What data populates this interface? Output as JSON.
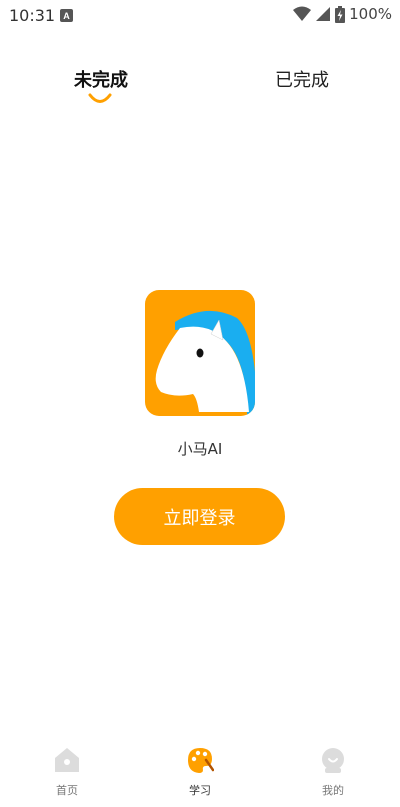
{
  "status_bar": {
    "time": "10:31",
    "battery": "100%"
  },
  "tabs": [
    {
      "label": "未完成",
      "active": true
    },
    {
      "label": "已完成",
      "active": false
    }
  ],
  "app": {
    "name": "小马AI"
  },
  "login": {
    "button_label": "立即登录"
  },
  "bottom_nav": [
    {
      "label": "首页",
      "icon": "home-icon",
      "active": false
    },
    {
      "label": "学习",
      "icon": "palette-icon",
      "active": true
    },
    {
      "label": "我的",
      "icon": "profile-icon",
      "active": false
    }
  ],
  "colors": {
    "accent": "#FFA000",
    "logo_blue": "#1AAEF0"
  }
}
